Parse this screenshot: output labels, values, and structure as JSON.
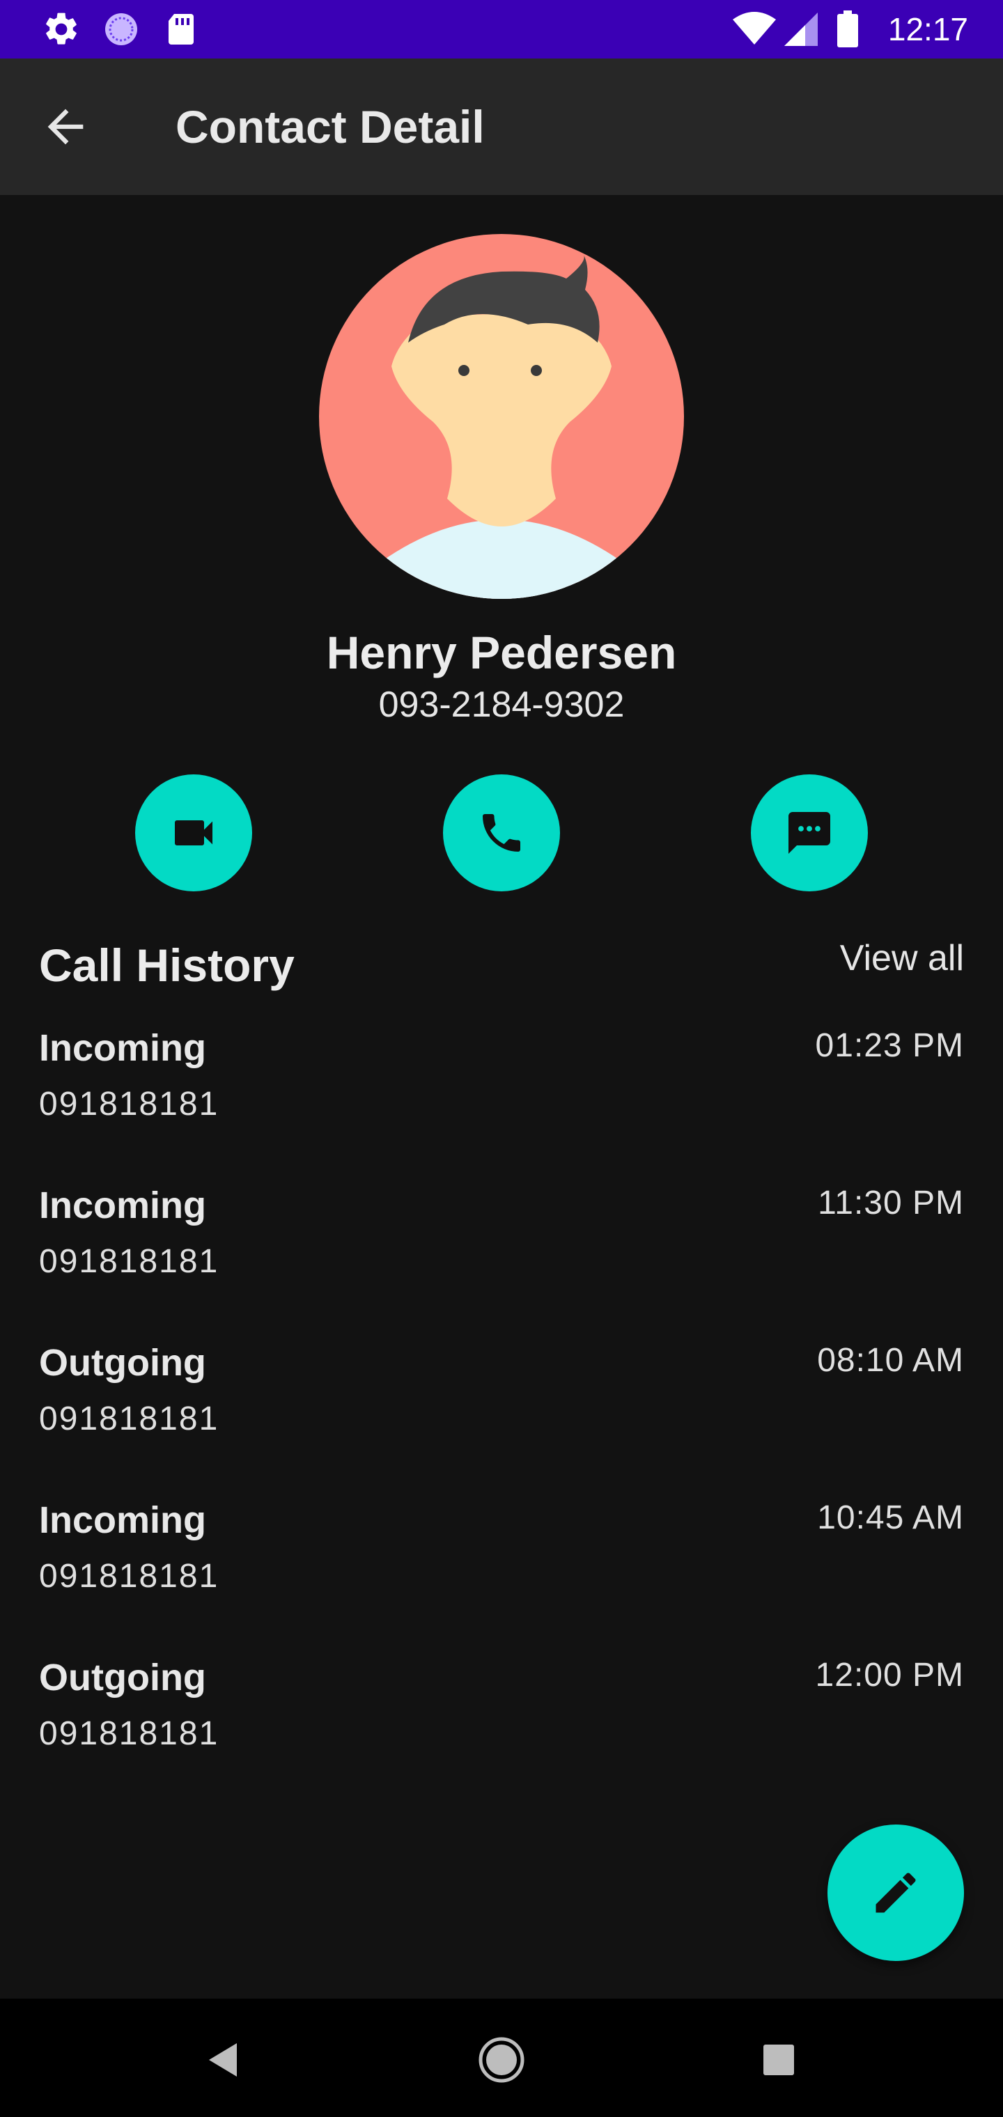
{
  "status_bar": {
    "time": "12:17",
    "left_icons": [
      "gear-icon",
      "sync-icon",
      "sd-card-icon"
    ],
    "right_icons": [
      "wifi-icon",
      "signal-icon",
      "battery-icon"
    ]
  },
  "app_bar": {
    "title": "Contact Detail",
    "back_icon": "arrow-back-icon"
  },
  "contact": {
    "name": "Henry Pedersen",
    "phone": "093-2184-9302"
  },
  "actions": [
    {
      "icon": "video-call-icon"
    },
    {
      "icon": "phone-icon"
    },
    {
      "icon": "message-icon"
    }
  ],
  "call_history": {
    "title": "Call History",
    "view_all": "View all",
    "items": [
      {
        "type": "Incoming",
        "number": "091818181",
        "time": "01:23 PM"
      },
      {
        "type": "Incoming",
        "number": "091818181",
        "time": "11:30 PM"
      },
      {
        "type": "Outgoing",
        "number": "091818181",
        "time": "08:10 AM"
      },
      {
        "type": "Incoming",
        "number": "091818181",
        "time": "10:45 AM"
      },
      {
        "type": "Outgoing",
        "number": "091818181",
        "time": "12:00 PM"
      }
    ]
  },
  "fab": {
    "icon": "edit-icon"
  },
  "nav_bar": {
    "icons": [
      "back-triangle-icon",
      "home-circle-icon",
      "recents-square-icon"
    ]
  },
  "colors": {
    "accent": "#03dac5",
    "status_bar": "#3b00b5",
    "app_bar": "#272727",
    "background": "#121212"
  }
}
